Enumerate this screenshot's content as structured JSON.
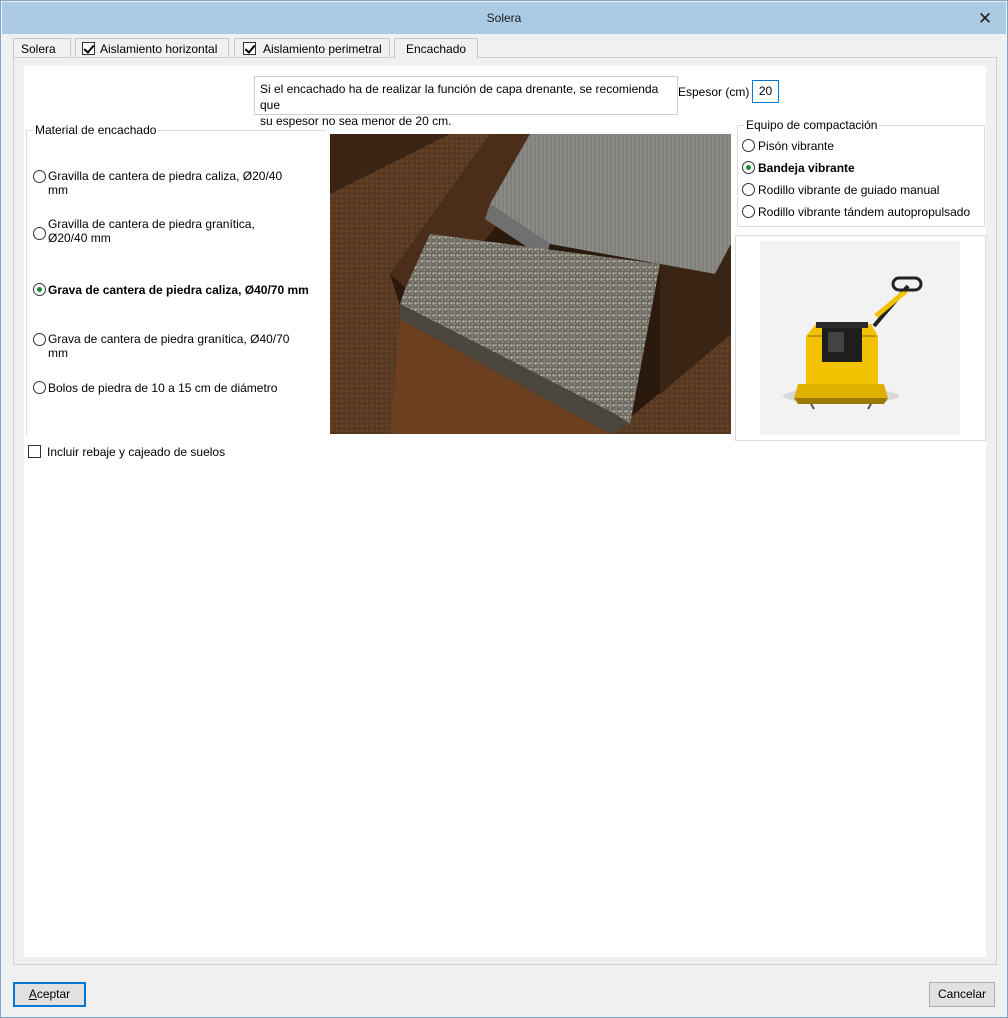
{
  "window": {
    "title": "Solera",
    "close_glyph": "✕"
  },
  "tabs": [
    {
      "label": "Solera",
      "checkbox": false,
      "checked": false,
      "active": false
    },
    {
      "label": "Aislamiento horizontal",
      "checkbox": true,
      "checked": true,
      "active": false
    },
    {
      "label": "Aislamiento perimetral",
      "checkbox": true,
      "checked": true,
      "active": false
    },
    {
      "label": "Encachado",
      "checkbox": false,
      "checked": false,
      "active": true
    }
  ],
  "tip": {
    "line1": "Si el encachado ha de realizar la función de capa drenante, se recomienda que",
    "line2": "su espesor no sea menor de 20 cm."
  },
  "espesor": {
    "label": "Espesor (cm)",
    "value": "20"
  },
  "material": {
    "title": "Material de encachado",
    "options": [
      {
        "line1": "Gravilla de cantera de piedra caliza, Ø20/40",
        "line2": "mm",
        "selected": false
      },
      {
        "line1": "Gravilla de cantera de piedra granítica,",
        "line2": "Ø20/40 mm",
        "selected": false
      },
      {
        "line1": "Grava de cantera de piedra caliza, Ø40/70 mm",
        "line2": "",
        "selected": true
      },
      {
        "line1": "Grava de cantera de piedra granítica, Ø40/70",
        "line2": "mm",
        "selected": false
      },
      {
        "line1": "Bolos de piedra de 10 a 15 cm de diámetro",
        "line2": "",
        "selected": false
      }
    ]
  },
  "equipo": {
    "title": "Equipo de compactación",
    "options": [
      {
        "label": "Pisón vibrante",
        "selected": false
      },
      {
        "label": "Bandeja vibrante",
        "selected": true
      },
      {
        "label": "Rodillo vibrante de guiado manual",
        "selected": false
      },
      {
        "label": "Rodillo vibrante tándem autopropulsado",
        "selected": false
      }
    ]
  },
  "incluir": {
    "label": "Incluir rebaje y cajeado de suelos",
    "checked": false
  },
  "buttons": {
    "accept_prefix": "A",
    "accept_rest": "ceptar",
    "cancel": "Cancelar"
  },
  "colors": {
    "titlebar": "#aacbe3",
    "radio_dot": "#1f8a3b",
    "accent": "#0078d7",
    "machine_yellow": "#f2c200"
  },
  "icons": {
    "close": "close-icon",
    "photo": "gravel-trench-image",
    "machine": "vibrating-plate-compactor-image"
  }
}
